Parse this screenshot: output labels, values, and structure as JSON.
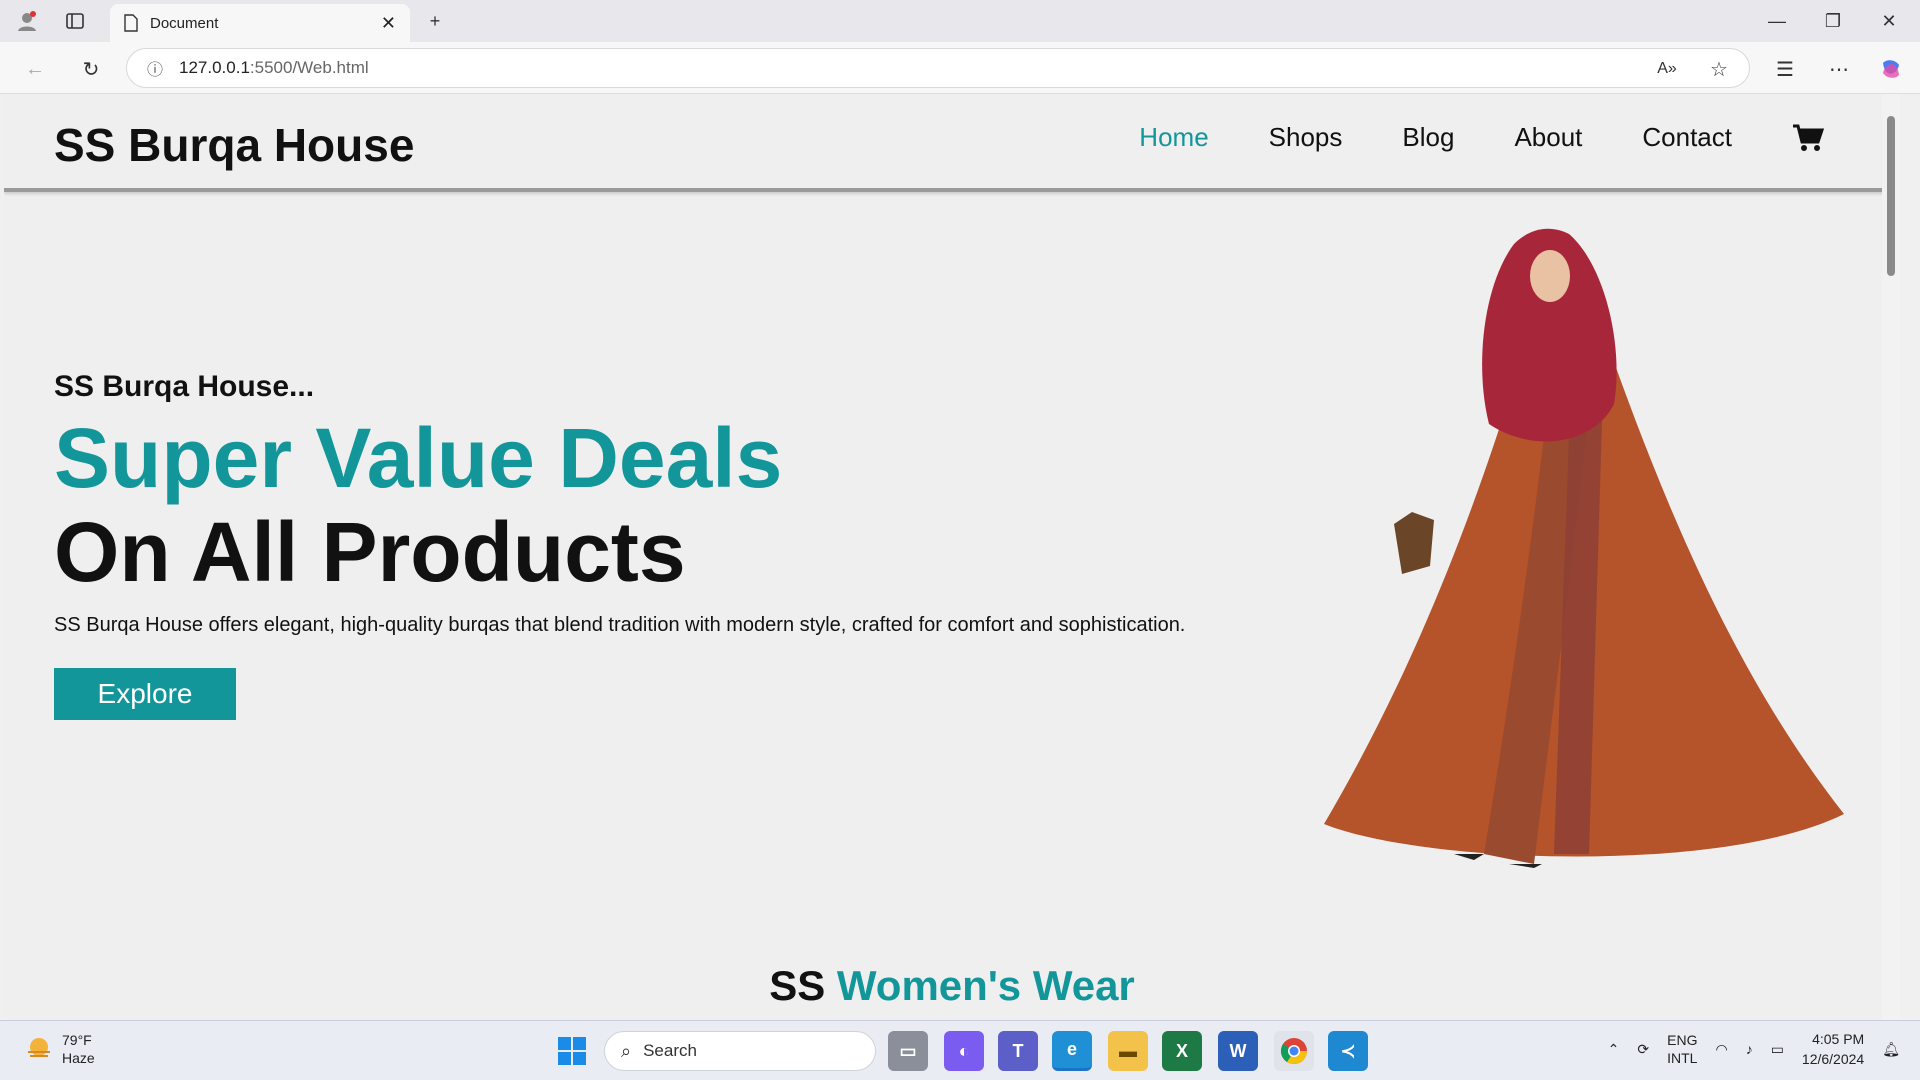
{
  "browser": {
    "tab_title": "Document",
    "url_host": "127.0.0.1",
    "url_path": ":5500/Web.html"
  },
  "header": {
    "logo": "SS Burqa House",
    "nav": [
      "Home",
      "Shops",
      "Blog",
      "About",
      "Contact"
    ],
    "active": "Home"
  },
  "hero": {
    "subtitle": "SS Burqa House...",
    "headline_1": "Super Value Deals",
    "headline_2": "On All Products",
    "description": "SS Burqa House offers elegant, high-quality burqas that blend tradition with modern style, crafted for comfort and sophistication.",
    "cta": "Explore"
  },
  "section": {
    "prefix": "SS",
    "title": "Women's Wear"
  },
  "taskbar": {
    "weather_temp": "79°F",
    "weather_desc": "Haze",
    "search_placeholder": "Search",
    "lang_1": "ENG",
    "lang_2": "INTL",
    "time": "4:05 PM",
    "date": "12/6/2024"
  },
  "colors": {
    "accent": "#13969a"
  }
}
